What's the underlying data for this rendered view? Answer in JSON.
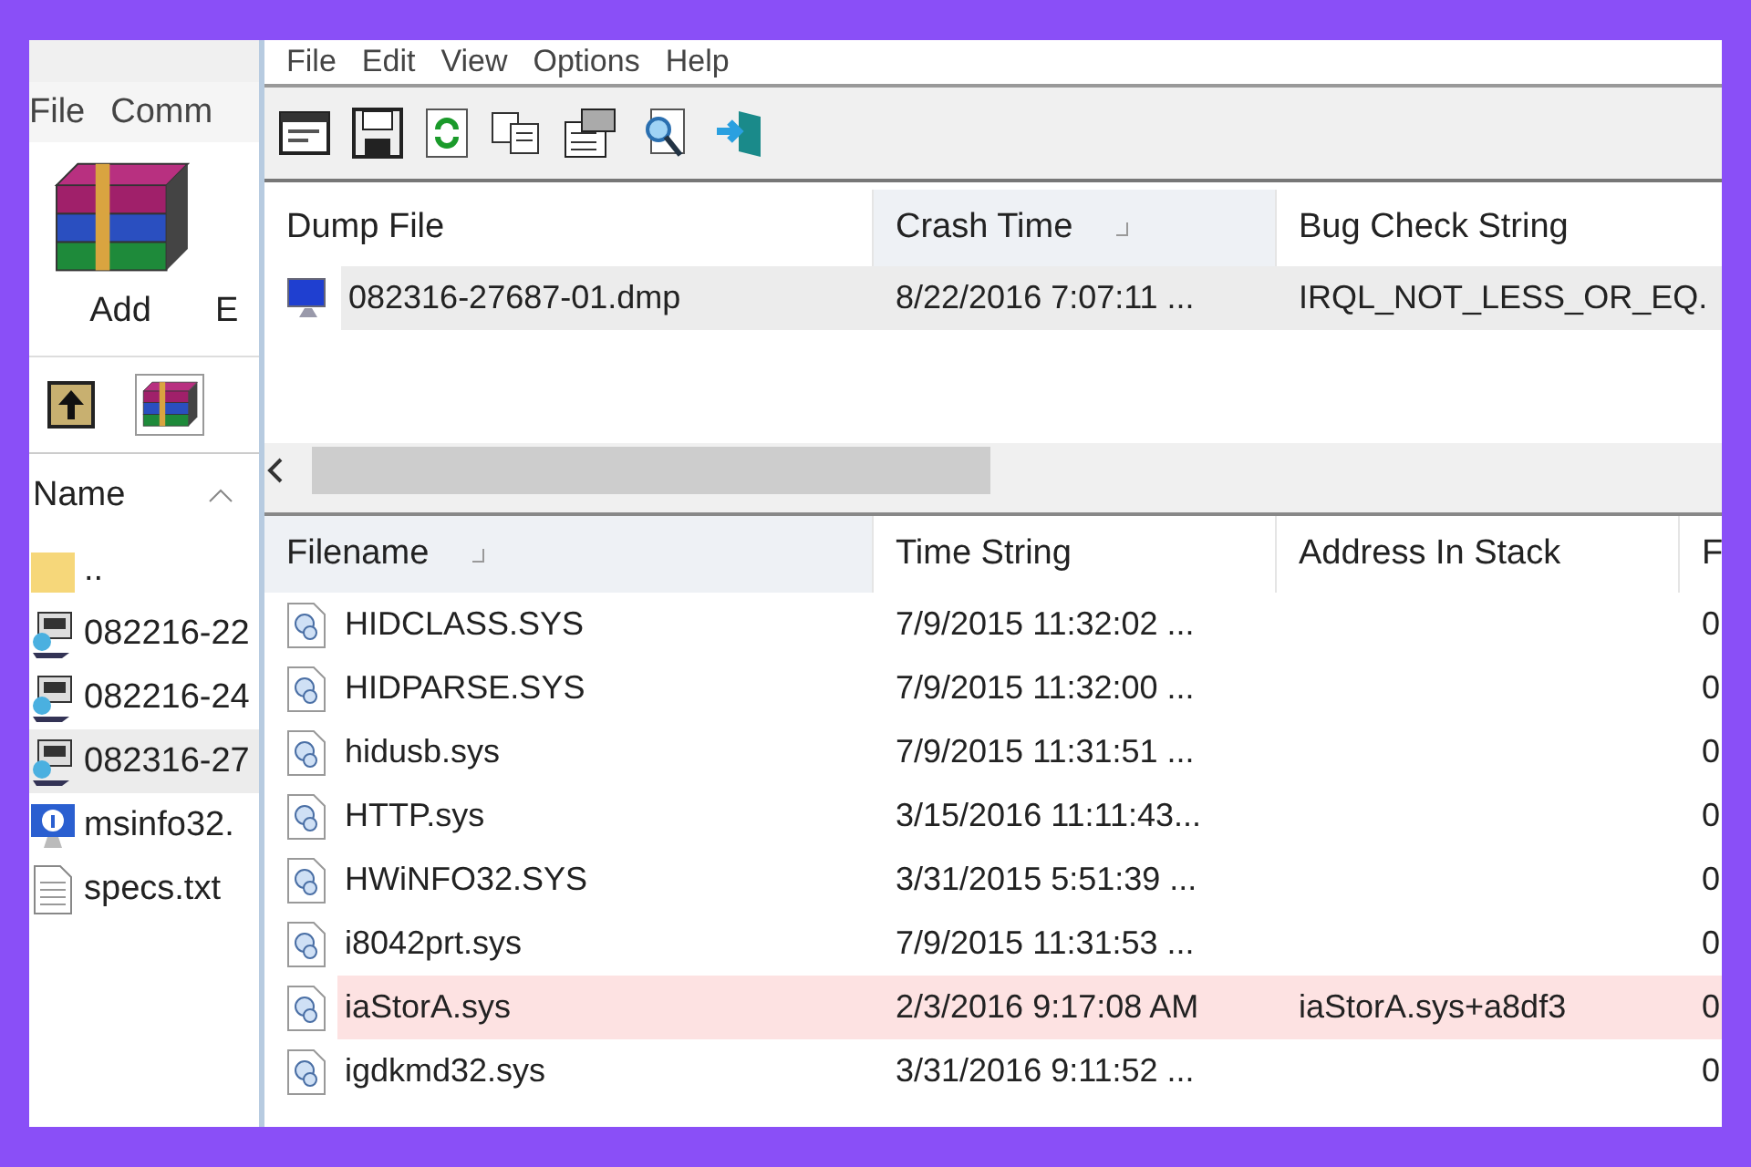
{
  "left_window": {
    "menu": [
      "File",
      "Comm"
    ],
    "toolbar": [
      {
        "label": "Add",
        "kind": "archive"
      },
      {
        "label": "E",
        "kind": "none"
      }
    ],
    "file_list": {
      "column": "Name",
      "rows": [
        {
          "name": "..",
          "kind": "folder",
          "selected": false
        },
        {
          "name": "082216-22",
          "kind": "dump",
          "selected": false
        },
        {
          "name": "082216-24",
          "kind": "dump",
          "selected": false
        },
        {
          "name": "082316-27",
          "kind": "dump",
          "selected": true
        },
        {
          "name": "msinfo32.",
          "kind": "info",
          "selected": false
        },
        {
          "name": "specs.txt",
          "kind": "text",
          "selected": false
        }
      ]
    }
  },
  "main_window": {
    "menu": [
      "File",
      "Edit",
      "View",
      "Options",
      "Help"
    ],
    "dump_list": {
      "columns": [
        {
          "label": "Dump File",
          "sorted": false
        },
        {
          "label": "Crash Time",
          "sorted": true
        },
        {
          "label": "Bug Check String",
          "sorted": false
        }
      ],
      "rows": [
        {
          "cells": [
            "082316-27687-01.dmp",
            "8/22/2016 7:07:11 ...",
            "IRQL_NOT_LESS_OR_EQ."
          ],
          "selected": true
        }
      ]
    },
    "driver_list": {
      "columns": [
        {
          "label": "Filename",
          "sorted": true
        },
        {
          "label": "Time String",
          "sorted": false
        },
        {
          "label": "Address In Stack",
          "sorted": false
        },
        {
          "label": "F",
          "sorted": false
        }
      ],
      "rows": [
        {
          "cells": [
            "HIDCLASS.SYS",
            "7/9/2015 11:32:02 ...",
            "",
            "0"
          ],
          "highlighted": false
        },
        {
          "cells": [
            "HIDPARSE.SYS",
            "7/9/2015 11:32:00 ...",
            "",
            "0"
          ],
          "highlighted": false
        },
        {
          "cells": [
            "hidusb.sys",
            "7/9/2015 11:31:51 ...",
            "",
            "0"
          ],
          "highlighted": false
        },
        {
          "cells": [
            "HTTP.sys",
            "3/15/2016 11:11:43...",
            "",
            "0"
          ],
          "highlighted": false
        },
        {
          "cells": [
            "HWiNFO32.SYS",
            "3/31/2015 5:51:39 ...",
            "",
            "0"
          ],
          "highlighted": false
        },
        {
          "cells": [
            "i8042prt.sys",
            "7/9/2015 11:31:53 ...",
            "",
            "0"
          ],
          "highlighted": false
        },
        {
          "cells": [
            "iaStorA.sys",
            "2/3/2016 9:17:08 AM",
            "iaStorA.sys+a8df3",
            "0"
          ],
          "highlighted": true
        },
        {
          "cells": [
            "igdkmd32.sys",
            "3/31/2016 9:11:52 ...",
            "",
            "0"
          ],
          "highlighted": false
        }
      ]
    }
  }
}
